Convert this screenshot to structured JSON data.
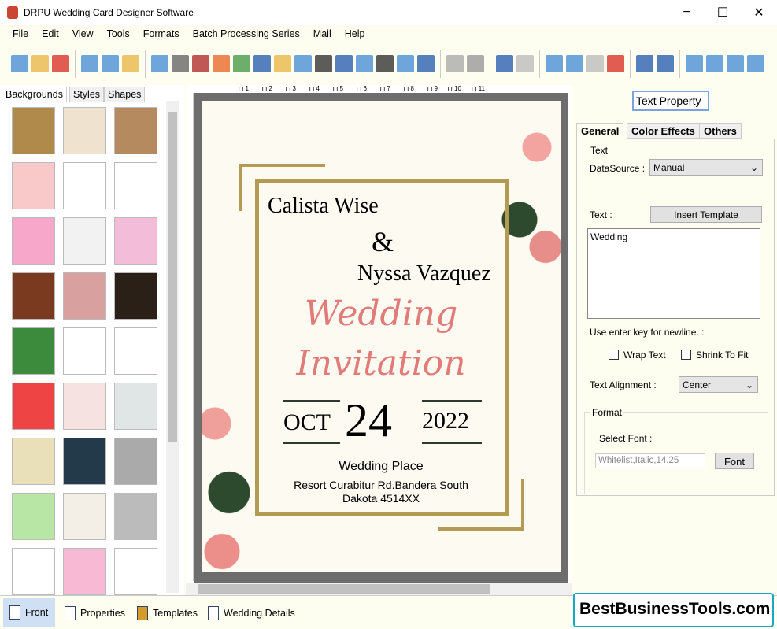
{
  "app": {
    "title": "DRPU Wedding Card Designer Software",
    "minimize": "−",
    "maximize": "☐",
    "close": "✕"
  },
  "menu": [
    "File",
    "Edit",
    "View",
    "Tools",
    "Formats",
    "Batch Processing Series",
    "Mail",
    "Help"
  ],
  "toolbar": [
    "new",
    "open",
    "close",
    "save",
    "save-as",
    "export",
    "properties",
    "print",
    "layers",
    "gift",
    "image",
    "pen",
    "shape",
    "watermark",
    "barcode",
    "text",
    "text-box",
    "signature",
    "mail",
    "line",
    "database",
    "database-2",
    "undo",
    "redo",
    "cut",
    "copy",
    "paste",
    "delete",
    "bring-front",
    "send-back",
    "grid",
    "actual-size",
    "fit",
    "zoom"
  ],
  "left": {
    "tabs": [
      "Backgrounds",
      "Styles",
      "Shapes"
    ],
    "thumb_colors": [
      "#b08a4a",
      "#efe2cf",
      "#b48a5e",
      "#f9c9c9",
      "#fff",
      "#fff",
      "#f7a7c9",
      "#f2f2f2",
      "#f3bcd8",
      "#7a3a20",
      "#d9a0a0",
      "#2a2018",
      "#3c8a3c",
      "#fff",
      "#fff",
      "#e44",
      "#f7e2e2",
      "#e0e6e6",
      "#e9dfb8",
      "#233a4a",
      "#aaa",
      "#b8e6a4",
      "#f3efe6",
      "#bbb",
      "#fff",
      "#f7b9d4",
      "#fff"
    ]
  },
  "card": {
    "name1": "Calista Wise",
    "amp": "&",
    "name2": "Nyssa Vazquez",
    "title1": "Wedding",
    "title2": "Invitation",
    "month": "OCT",
    "day": "24",
    "year": "2022",
    "place": "Wedding Place",
    "address1": "Resort Curabitur Rd.Bandera South",
    "address2": "Dakota 4514XX",
    "accent": "#e07b78",
    "gold": "#b49b53"
  },
  "ruler": [
    "1",
    "2",
    "3",
    "4",
    "5",
    "6",
    "7",
    "8",
    "9",
    "10",
    "11"
  ],
  "right": {
    "header": "Text Property",
    "tabs": [
      "General",
      "Color Effects",
      "Others"
    ],
    "text_group": "Text",
    "datasource_label": "DataSource :",
    "datasource": "Manual",
    "text_label": "Text :",
    "insert_template": "Insert Template",
    "text_value": "Wedding",
    "newline_hint": "Use enter key for newline. :",
    "wrap": "Wrap Text",
    "shrink": "Shrink To Fit",
    "align_label": "Text Alignment :",
    "align": "Center",
    "format_group": "Format",
    "select_font": "Select Font :",
    "font_value": "Whitelist,Italic,14.25",
    "font_btn": "Font"
  },
  "bottom": {
    "items": [
      "Front",
      "Properties",
      "Templates",
      "Wedding Details"
    ],
    "brand": "BestBusinessTools.com"
  }
}
